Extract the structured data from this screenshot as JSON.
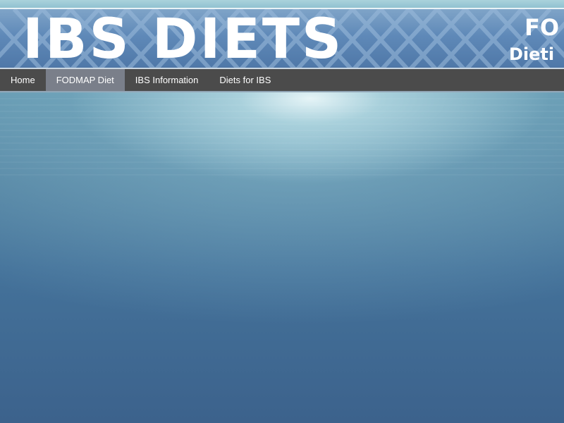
{
  "header": {
    "title": "IBS DIETS",
    "subtitle_line1": "FO",
    "subtitle_line2": "Dieti"
  },
  "nav": {
    "items": [
      {
        "label": "Home",
        "active": false
      },
      {
        "label": "FODMAP Diet",
        "active": true
      },
      {
        "label": "IBS Information",
        "active": false
      },
      {
        "label": "Diets for IBS",
        "active": false
      }
    ]
  },
  "colors": {
    "nav_background": "#4b4b4b",
    "nav_active": "#7a7f8a",
    "banner": "#5f89b8",
    "page_background": "#44729a"
  }
}
